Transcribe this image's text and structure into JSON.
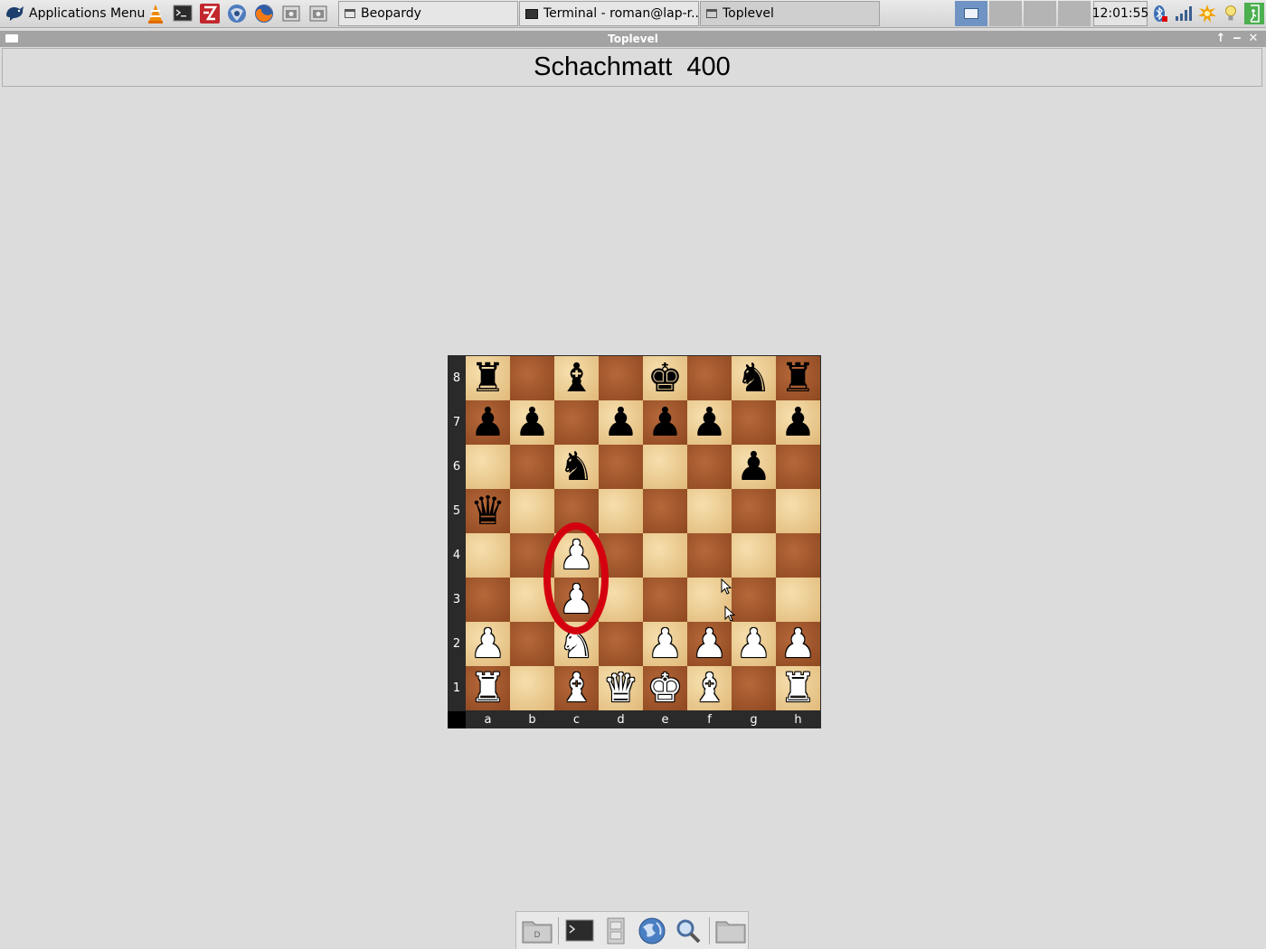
{
  "panel": {
    "app_menu_label": "Applications Menu",
    "launchers": [
      "vlc-icon",
      "terminal-icon",
      "filezilla-icon",
      "thunderbird-icon",
      "firefox-icon",
      "screenshot-icon",
      "screenshot-2-icon"
    ],
    "tasks": [
      {
        "label": "Beopardy",
        "icon": "window-icon"
      },
      {
        "label": "Terminal - roman@lap-r...",
        "icon": "terminal-icon"
      },
      {
        "label": "Toplevel",
        "icon": "window-icon",
        "active": true
      }
    ],
    "workspaces": 4,
    "active_workspace": 1,
    "clock": "12:01:55",
    "tray": [
      "bluetooth-icon",
      "network-signal-icon",
      "notification-icon",
      "brightness-icon",
      "logout-icon"
    ]
  },
  "window": {
    "title": "Toplevel",
    "header": "Schachmatt  400"
  },
  "board": {
    "ranks": [
      "8",
      "7",
      "6",
      "5",
      "4",
      "3",
      "2",
      "1"
    ],
    "files": [
      "a",
      "b",
      "c",
      "d",
      "e",
      "f",
      "g",
      "h"
    ],
    "position": [
      [
        "r",
        "",
        "b",
        "",
        "k",
        "",
        "n",
        "r"
      ],
      [
        "p",
        "p",
        "",
        "p",
        "p",
        "p",
        "",
        "p"
      ],
      [
        "",
        "",
        "n",
        "",
        "",
        "",
        "p",
        ""
      ],
      [
        "q",
        "",
        "",
        "",
        "",
        "",
        "",
        ""
      ],
      [
        "",
        "",
        "P",
        "",
        "",
        "",
        "",
        ""
      ],
      [
        "",
        "",
        "P",
        "",
        "",
        "",
        "",
        ""
      ],
      [
        "P",
        "",
        "N",
        "",
        "P",
        "P",
        "P",
        "P"
      ],
      [
        "R",
        "",
        "B",
        "Q",
        "K",
        "B",
        "",
        "R"
      ]
    ],
    "highlight": "red-ellipse-annotation",
    "highlight_color": "#d4000f"
  },
  "dock": {
    "items": [
      "home-folder-icon",
      "terminal-icon",
      "file-cabinet-icon",
      "web-browser-icon",
      "search-icon",
      "folder-icon"
    ]
  }
}
